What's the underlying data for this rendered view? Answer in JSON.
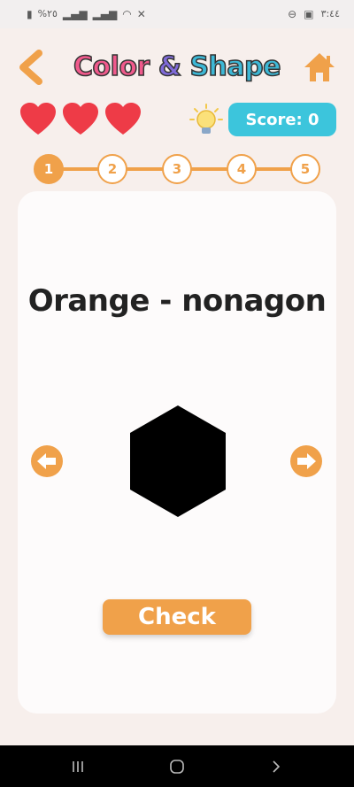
{
  "status_bar": {
    "battery": "%٢٥",
    "net1": "Vo))\nLTE2",
    "net2": "Vo))\nLTE1",
    "time": "٣:٤٤"
  },
  "header": {
    "title_parts": [
      "Color",
      " ",
      "&",
      " ",
      "Shape"
    ],
    "back_icon": "chevron-left",
    "home_icon": "house"
  },
  "stats": {
    "lives": 3,
    "score_label": "Score: 0",
    "hint_icon": "lightbulb"
  },
  "steps": {
    "labels": [
      "1",
      "2",
      "3",
      "4",
      "5"
    ],
    "current": 1
  },
  "question": {
    "prompt": "Orange - nonagon",
    "shape": "hexagon",
    "shape_color": "#000000"
  },
  "actions": {
    "check_label": "Check"
  },
  "colors": {
    "accent": "#f0a14a",
    "score_bg": "#3cc5dc",
    "heart": "#ee3b47"
  }
}
